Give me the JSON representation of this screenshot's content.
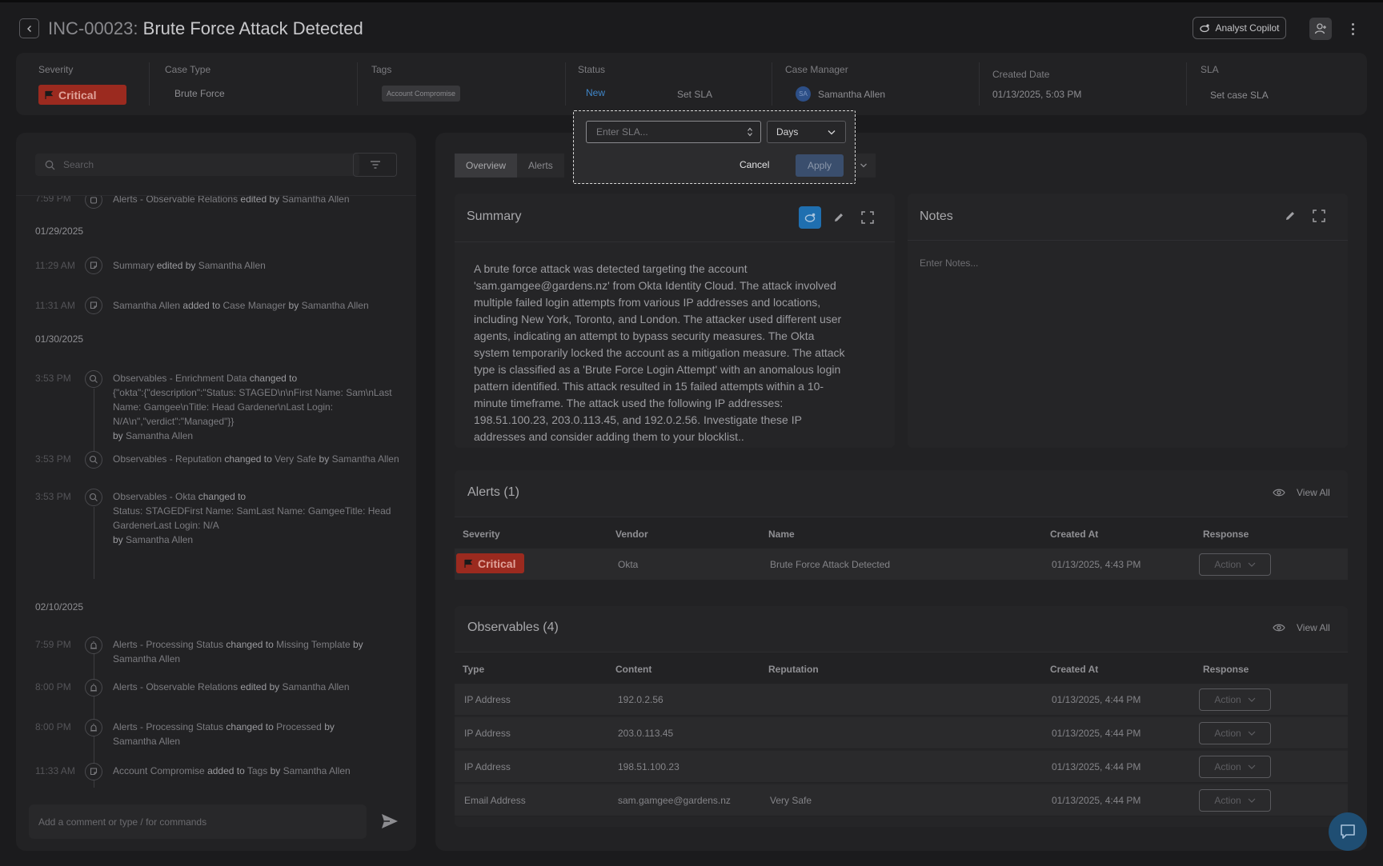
{
  "header": {
    "incident_id": "INC-00023:",
    "incident_title": "Brute Force Attack Detected",
    "copilot_label": "Analyst Copilot"
  },
  "info": {
    "severity_label": "Severity",
    "severity_value": "Critical",
    "case_type_label": "Case Type",
    "case_type_value": "Brute Force",
    "tags_label": "Tags",
    "tag_value": "Account Compromise",
    "status_label": "Status",
    "status_value": "New",
    "set_sla": "Set SLA",
    "case_manager_label": "Case Manager",
    "case_manager_initials": "SA",
    "case_manager_value": "Samantha Allen",
    "created_label": "Created Date",
    "created_value": "01/13/2025, 5:03 PM",
    "sla_label": "SLA",
    "sla_value": "Set case SLA"
  },
  "left": {
    "search_placeholder": "Search",
    "comment_placeholder": "Add a comment or type / for commands",
    "top_partial": {
      "time": "7:59 PM",
      "a": "Alerts - Observable Relations",
      "b": "edited by",
      "c": "Samantha Allen"
    },
    "dates": [
      "01/29/2025",
      "01/30/2025",
      "02/10/2025"
    ],
    "entries": [
      {
        "time": "11:29 AM",
        "a": "Summary",
        "b": "edited by",
        "c": "Samantha Allen"
      },
      {
        "time": "11:31 AM",
        "a": "Samantha Allen",
        "b": "added to",
        "c": "Case Manager",
        "d": "by",
        "e": "Samantha Allen"
      },
      {
        "time": "3:53 PM",
        "a": "Observables - Enrichment Data",
        "b": "changed to",
        "c": "{\"okta\":{\"description\":\"Status: STAGED\\n\\nFirst Name: Sam\\nLast Name: Gamgee\\nTitle: Head Gardener\\nLast Login: N/A\\n\",\"verdict\":\"Managed\"}}",
        "d": "by",
        "e": "Samantha Allen"
      },
      {
        "time": "3:53 PM",
        "a": "Observables - Reputation",
        "b": "changed to",
        "c": "Very Safe",
        "d": "by",
        "e": "Samantha Allen"
      },
      {
        "time": "3:53 PM",
        "a": "Observables - Okta",
        "b": "changed to",
        "c": "Status: STAGEDFirst Name: SamLast Name: GamgeeTitle: Head GardenerLast Login: N/A",
        "d": "by",
        "e": "Samantha Allen"
      },
      {
        "time": "7:59 PM",
        "a": "Alerts - Processing Status",
        "b": "changed to",
        "c": "Missing Template",
        "d": "by",
        "e": "Samantha Allen"
      },
      {
        "time": "8:00 PM",
        "a": "Alerts - Observable Relations",
        "b": "edited by",
        "c": "Samantha Allen"
      },
      {
        "time": "8:00 PM",
        "a": "Alerts - Processing Status",
        "b": "changed to",
        "c": "Processed",
        "d": "by",
        "e": "Samantha Allen"
      },
      {
        "time": "11:33 AM",
        "a": "Account Compromise",
        "b": "added to",
        "c": "Tags",
        "d": "by",
        "e": "Samantha Allen"
      }
    ]
  },
  "tabs": [
    "Overview",
    "Alerts"
  ],
  "summary": {
    "title": "Summary",
    "text": "A brute force attack was detected targeting the account 'sam.gamgee@gardens.nz' from Okta Identity Cloud. The attack involved multiple failed login attempts from various IP addresses and locations, including New York, Toronto, and London. The attacker used different user agents, indicating an attempt to bypass security measures.  The Okta system temporarily locked the account as a mitigation measure. The attack type is classified as a 'Brute Force Login Attempt' with an anomalous login pattern identified. This attack resulted in 15 failed attempts within a 10-minute timeframe.  The attack used the following IP addresses: 198.51.100.23, 203.0.113.45, and 192.0.2.56.  Investigate these IP addresses and consider adding them to your blocklist.."
  },
  "notes": {
    "title": "Notes",
    "placeholder": "Enter Notes..."
  },
  "alerts": {
    "title": "Alerts (1)",
    "view_all": "View All",
    "headers": [
      "Severity",
      "Vendor",
      "Name",
      "Created At",
      "Response"
    ],
    "rows": [
      {
        "severity": "Critical",
        "vendor": "Okta",
        "name": "Brute Force Attack Detected",
        "created": "01/13/2025, 4:43 PM",
        "action": "Action"
      }
    ]
  },
  "observables": {
    "title": "Observables (4)",
    "view_all": "View All",
    "headers": [
      "Type",
      "Content",
      "Reputation",
      "Created At",
      "Response"
    ],
    "rows": [
      {
        "type": "IP Address",
        "content": "192.0.2.56",
        "reputation": "",
        "created": "01/13/2025, 4:44 PM",
        "action": "Action"
      },
      {
        "type": "IP Address",
        "content": "203.0.113.45",
        "reputation": "",
        "created": "01/13/2025, 4:44 PM",
        "action": "Action"
      },
      {
        "type": "IP Address",
        "content": "198.51.100.23",
        "reputation": "",
        "created": "01/13/2025, 4:44 PM",
        "action": "Action"
      },
      {
        "type": "Email Address",
        "content": "sam.gamgee@gardens.nz",
        "reputation": "Very Safe",
        "created": "01/13/2025, 4:44 PM",
        "action": "Action"
      }
    ]
  },
  "sla_popover": {
    "input_placeholder": "Enter SLA...",
    "unit": "Days",
    "cancel": "Cancel",
    "apply": "Apply"
  },
  "colors": {
    "critical": "#9b2a1f",
    "accent_blue": "#1f6fb0",
    "status_new": "#3f86c9"
  }
}
